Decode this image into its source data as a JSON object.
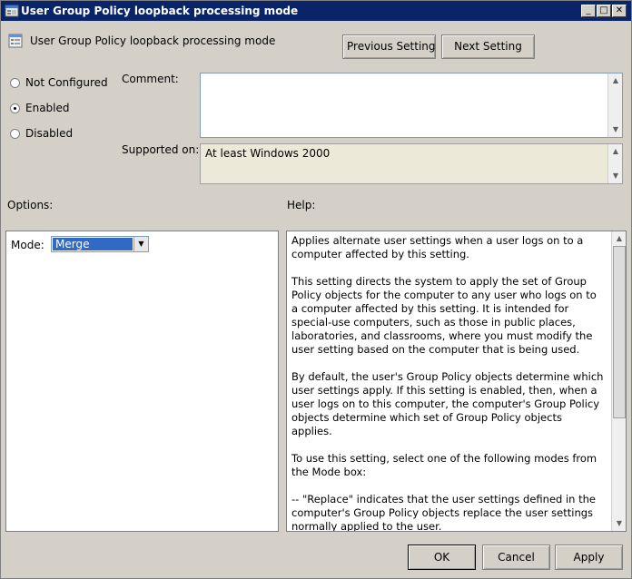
{
  "window": {
    "title": "User Group Policy loopback processing mode",
    "minimize_glyph": "_",
    "maximize_glyph": "□",
    "close_glyph": "✕"
  },
  "header": {
    "policy_name": "User Group Policy loopback processing mode",
    "previous_label": "Previous Setting",
    "next_label": "Next Setting"
  },
  "state": {
    "not_configured_label": "Not Configured",
    "enabled_label": "Enabled",
    "disabled_label": "Disabled",
    "selected": "Enabled"
  },
  "comment": {
    "label": "Comment:",
    "value": ""
  },
  "supported": {
    "label": "Supported on:",
    "value": "At least Windows 2000"
  },
  "options": {
    "label": "Options:",
    "mode_label": "Mode:",
    "mode_value": "Merge"
  },
  "help": {
    "label": "Help:",
    "paragraphs": [
      "Applies alternate user settings when a user logs on to a computer affected by this setting.",
      "This setting directs the system to apply the set of Group Policy objects for the computer to any user who logs on to a computer affected by this setting. It is intended for special-use computers, such as those in public places, laboratories, and classrooms, where you must modify the user setting based on the computer that is being used.",
      "By default, the user's Group Policy objects determine which user settings apply. If this setting is enabled, then, when a user logs on to this computer, the computer's Group Policy objects determine which set of Group Policy objects applies.",
      "To use this setting, select one of the following modes from the Mode box:",
      "--   \"Replace\" indicates that the user settings defined in the computer's Group Policy objects replace the user settings normally applied to the user."
    ]
  },
  "footer": {
    "ok_label": "OK",
    "cancel_label": "Cancel",
    "apply_label": "Apply"
  },
  "icons": {
    "app": "policy-window-icon",
    "policy": "policy-setting-icon"
  }
}
